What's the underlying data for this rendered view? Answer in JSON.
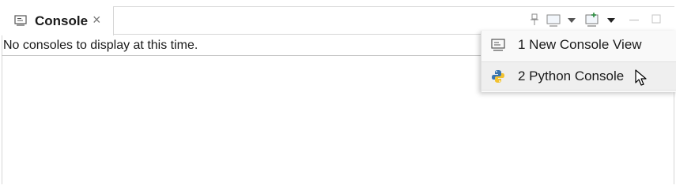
{
  "tab": {
    "label": "Console",
    "close_glyph": "×",
    "icon": "console-icon"
  },
  "toolbar": {
    "icons": [
      "pin-icon",
      "display-console-icon",
      "dropdown-arrow-icon",
      "open-console-icon",
      "dropdown-arrow-icon",
      "minimize-icon",
      "maximize-icon"
    ]
  },
  "content": {
    "message": "No consoles to display at this time."
  },
  "menu": {
    "items": [
      {
        "label": "1 New Console View",
        "icon": "console-view-icon"
      },
      {
        "label": "2 Python Console",
        "icon": "python-icon"
      }
    ]
  }
}
